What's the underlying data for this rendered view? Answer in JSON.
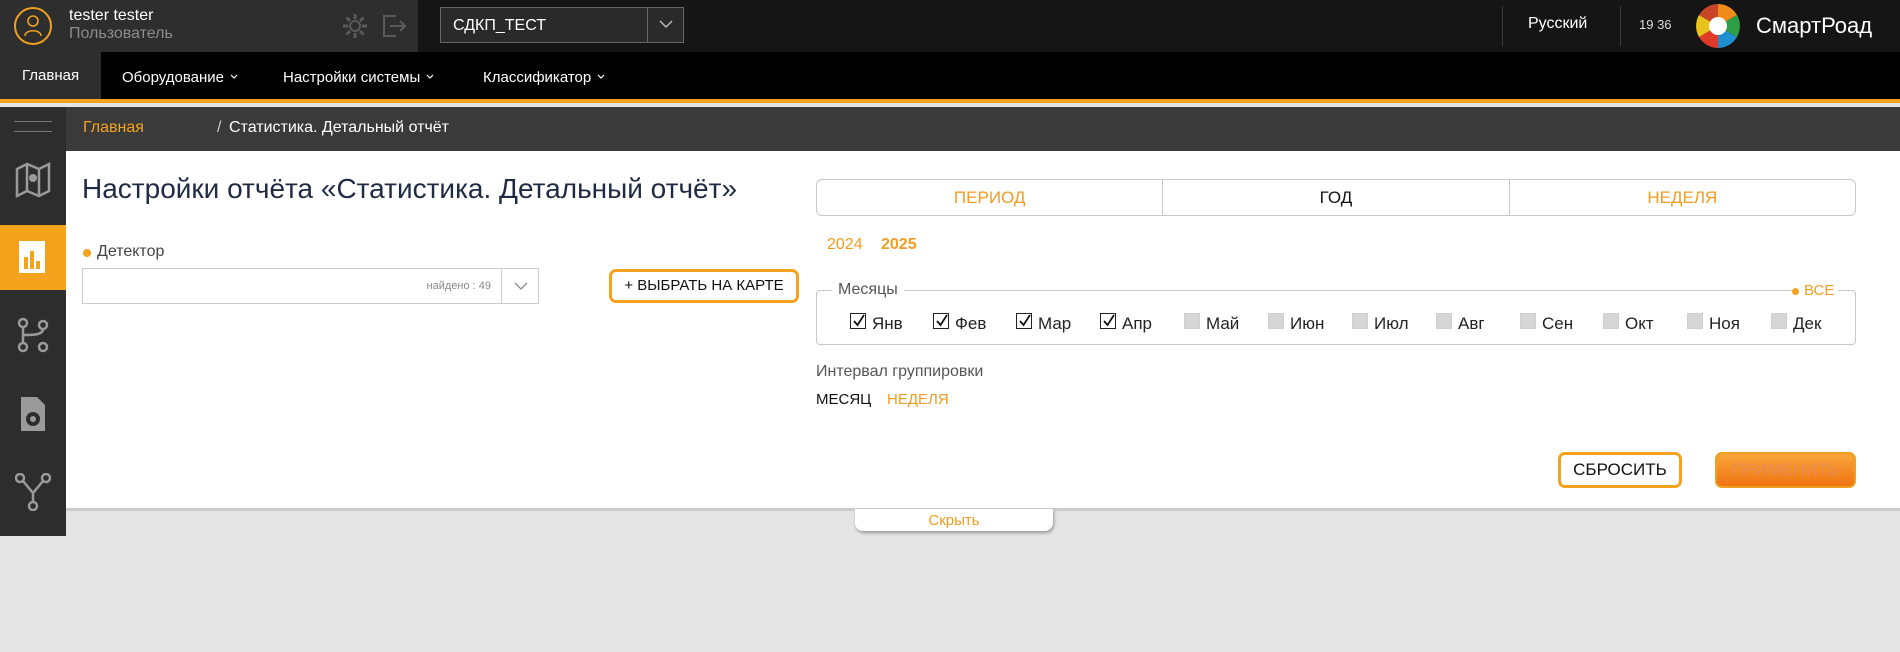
{
  "user": {
    "name": "tester tester",
    "role": "Пользователь"
  },
  "project": {
    "selected": "СДКП_ТЕСТ"
  },
  "header": {
    "language": "Русский",
    "time": "19 36",
    "brand": "СмартРоад"
  },
  "nav": {
    "items": [
      {
        "label": "Главная",
        "active": true
      },
      {
        "label": "Оборудование",
        "dropdown": true
      },
      {
        "label": "Настройки системы",
        "dropdown": true
      },
      {
        "label": "Классификатор",
        "dropdown": true
      }
    ]
  },
  "sidebar": {
    "items": [
      {
        "icon": "map-icon"
      },
      {
        "icon": "chart-report-icon",
        "active": true
      },
      {
        "icon": "route-icon"
      },
      {
        "icon": "device-icon"
      },
      {
        "icon": "network-icon"
      }
    ]
  },
  "breadcrumb": {
    "home": "Главная",
    "separator": "/",
    "current": "Статистика. Детальный отчёт"
  },
  "page": {
    "title": "Настройки отчёта «Статистика. Детальный отчёт»"
  },
  "detector": {
    "label": "Детектор",
    "value": "",
    "found": "найдено : 49"
  },
  "select_on_map_label": "+ ВЫБРАТЬ НА КАРТЕ",
  "period_tabs": [
    {
      "label": "ПЕРИОД",
      "active": false
    },
    {
      "label": "ГОД",
      "active": true
    },
    {
      "label": "НЕДЕЛЯ",
      "active": false
    }
  ],
  "years": [
    {
      "label": "2024",
      "selected": false
    },
    {
      "label": "2025",
      "selected": true
    }
  ],
  "months": {
    "legend": "Месяцы",
    "all_label": "ВСЕ",
    "items": [
      {
        "label": "Янв",
        "checked": true
      },
      {
        "label": "Фев",
        "checked": true
      },
      {
        "label": "Мар",
        "checked": true
      },
      {
        "label": "Апр",
        "checked": true
      },
      {
        "label": "Май",
        "checked": false
      },
      {
        "label": "Июн",
        "checked": false
      },
      {
        "label": "Июл",
        "checked": false
      },
      {
        "label": "Авг",
        "checked": false
      },
      {
        "label": "Сен",
        "checked": false
      },
      {
        "label": "Окт",
        "checked": false
      },
      {
        "label": "Ноя",
        "checked": false
      },
      {
        "label": "Дек",
        "checked": false
      }
    ]
  },
  "interval": {
    "label": "Интервал группировки",
    "month": "МЕСЯЦ",
    "week": "НЕДЕЛЯ",
    "selected": "МЕСЯЦ"
  },
  "actions": {
    "reset": "СБРОСИТЬ",
    "apply": "ПРИМЕНИТЬ"
  },
  "hide_label": "Скрыть",
  "colors": {
    "accent": "#f5a21d",
    "topbar": "#151515",
    "sidebar": "#2d2d2d",
    "crumbbar": "#3a3a3a"
  }
}
